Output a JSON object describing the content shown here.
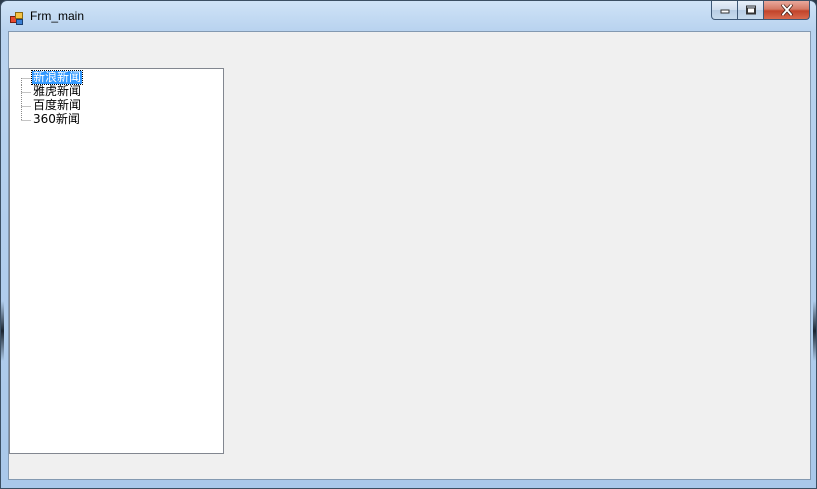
{
  "window": {
    "title": "Frm_main",
    "icon": "form-app-icon"
  },
  "caption_buttons": [
    "minimize-icon",
    "maximize-icon",
    "close-icon"
  ],
  "tree": {
    "selected_index": 0,
    "nodes": [
      {
        "label": "新浪新闻"
      },
      {
        "label": "雅虎新闻"
      },
      {
        "label": "百度新闻"
      },
      {
        "label": "360新闻"
      }
    ]
  },
  "colors": {
    "selection": "#3399ff",
    "client_background": "#f0f0f0",
    "tree_background": "#ffffff"
  }
}
